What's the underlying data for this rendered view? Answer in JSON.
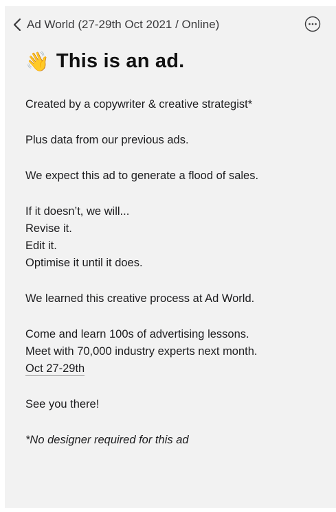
{
  "nav": {
    "title": "Ad World (27-29th Oct 2021 / Online)"
  },
  "post": {
    "headline_emoji": "👋",
    "headline": "This is an ad.",
    "p1": "Created by a copywriter & creative strategist*",
    "p2": "Plus data from our previous ads.",
    "p3": "We expect this ad to generate a flood of sales.",
    "p4_lines": [
      "If it doesn’t, we will...",
      "Revise it.",
      "Edit it.",
      "Optimise it until it does."
    ],
    "p5": "We learned this creative process at Ad World.",
    "p6_lines": [
      "Come and learn 100s of advertising lessons.",
      "Meet with 70,000 industry experts next month."
    ],
    "date_link": "Oct 27-29th",
    "p7": "See you there!",
    "footnote": "*No designer required for this ad"
  },
  "icons": {
    "back": "chevron-left-icon",
    "more": "ellipsis-circle-icon"
  }
}
